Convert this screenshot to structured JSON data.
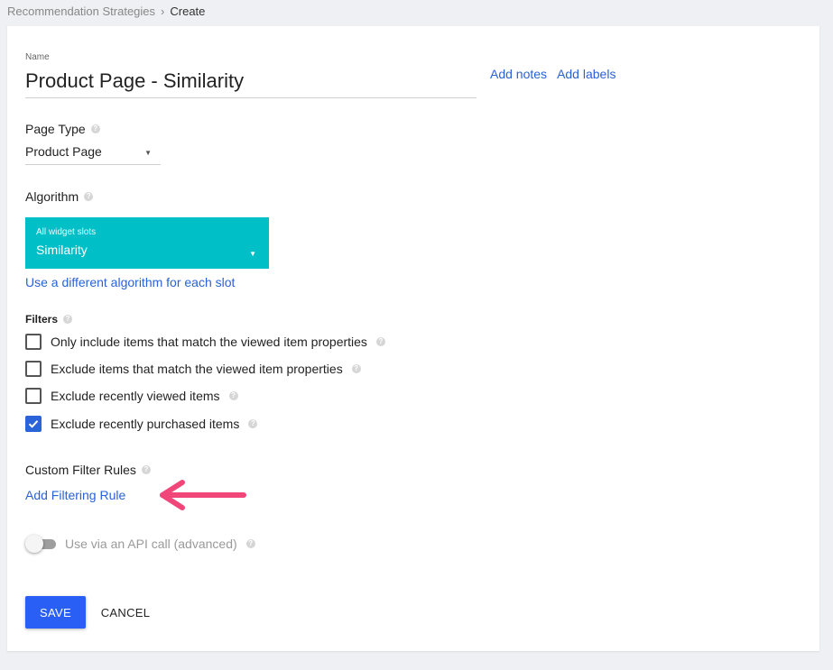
{
  "breadcrumb": {
    "parent": "Recommendation Strategies",
    "separator": "›",
    "current": "Create"
  },
  "form": {
    "name_label": "Name",
    "name_value": "Product Page - Similarity",
    "add_notes": "Add notes",
    "add_labels": "Add labels",
    "page_type_label": "Page Type",
    "page_type_value": "Product Page",
    "algorithm_label": "Algorithm",
    "algorithm_slots_label": "All widget slots",
    "algorithm_value": "Similarity",
    "algorithm_link": "Use a different algorithm for each slot",
    "filters_label": "Filters",
    "filters": [
      {
        "label": "Only include items that match the viewed item properties",
        "checked": false
      },
      {
        "label": "Exclude items that match the viewed item properties",
        "checked": false
      },
      {
        "label": "Exclude recently viewed items",
        "checked": false
      },
      {
        "label": "Exclude recently purchased items",
        "checked": true
      }
    ],
    "custom_rules_label": "Custom Filter Rules",
    "add_rule_link": "Add Filtering Rule",
    "api_toggle_label": "Use via an API call (advanced)",
    "api_toggle_on": false,
    "help_glyph": "?"
  },
  "actions": {
    "save": "SAVE",
    "cancel": "CANCEL"
  },
  "colors": {
    "accent": "#2a5ff5",
    "link": "#2a62d6",
    "algorithm_bg": "#00bfc7",
    "arrow": "#f0467a"
  }
}
